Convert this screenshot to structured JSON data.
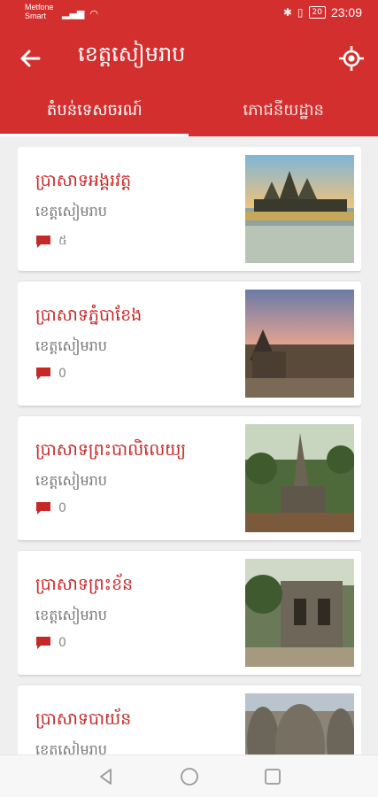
{
  "status_bar": {
    "carrier_line1": "Metfone",
    "carrier_line2": "Smart",
    "battery": "20",
    "time": "23:09"
  },
  "app_bar": {
    "title": "ខេត្តសៀមរាប",
    "back_icon": "arrow-back-icon",
    "location_icon": "my-location-icon"
  },
  "tabs": [
    {
      "label": "តំបន់ទេសចរណ៍",
      "active": true
    },
    {
      "label": "ភោជនីយដ្ឋាន",
      "active": false
    }
  ],
  "places": [
    {
      "name": "ប្រាសាទអង្គរវត្ត",
      "province": "ខេត្តសៀមរាប",
      "comments": "៥"
    },
    {
      "name": "ប្រាសាទភ្នំបាខែង",
      "province": "ខេត្តសៀមរាប",
      "comments": "0"
    },
    {
      "name": "ប្រាសាទព្រះបាលិលេយ្យ",
      "province": "ខេត្តសៀមរាប",
      "comments": "0"
    },
    {
      "name": "ប្រាសាទព្រះខ័ន",
      "province": "ខេត្តសៀមរាប",
      "comments": "0"
    },
    {
      "name": "ប្រាសាទបាយ័ន",
      "province": "ខេត្តសៀមរាប",
      "comments": ""
    }
  ],
  "colors": {
    "primary": "#d32f2f",
    "title_text": "#c62828",
    "subtitle_text": "#777777"
  }
}
